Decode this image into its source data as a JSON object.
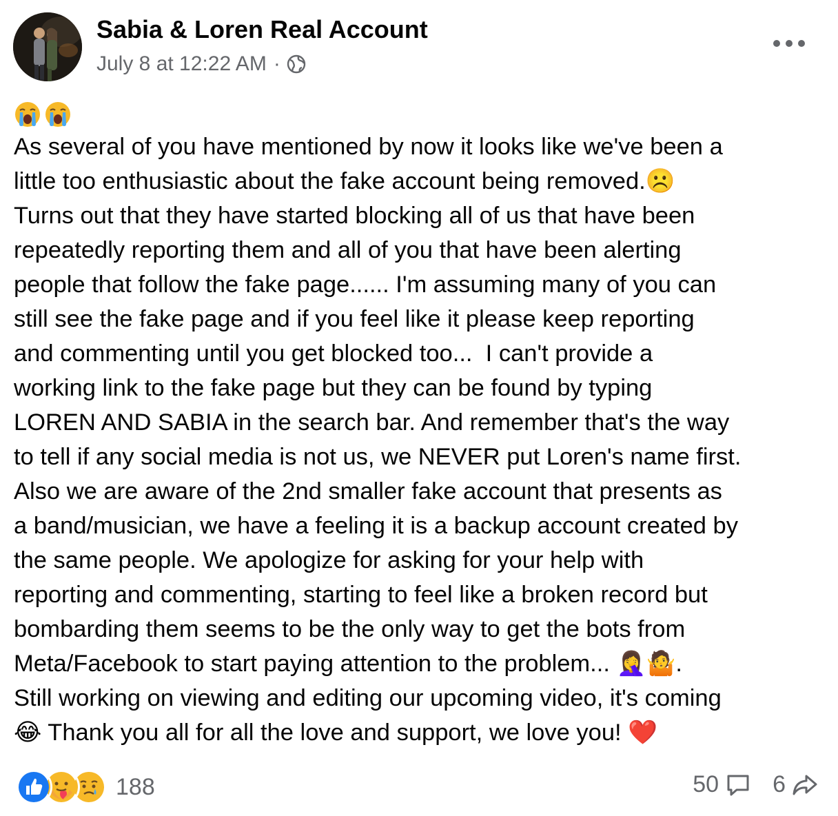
{
  "post": {
    "author": "Sabia & Loren Real Account",
    "timestamp": "July 8 at 12:22 AM",
    "separator": "·",
    "audience_icon": "globe-icon",
    "leading_emoji": [
      "😭",
      "😭"
    ],
    "body_lines": [
      "As several of you have mentioned by now it looks like we've been a",
      "little too enthusiastic about the fake account being removed.☹️",
      "Turns out that they have started blocking all of us that have been",
      "repeatedly reporting them and all of you that have been alerting",
      "people that follow the fake page...... I'm assuming many of you can",
      "still see the fake page and if you feel like it please keep reporting",
      "and commenting until you get blocked too...  I can't provide a",
      "working link to the fake page but they can be found by typing",
      "LOREN AND SABIA in the search bar. And remember that's the way",
      "to tell if any social media is not us, we NEVER put Loren's name first.",
      "Also we are aware of the 2nd smaller fake account that presents as",
      "a band/musician, we have a feeling it is a backup account created by",
      "the same people. We apologize for asking for your help with",
      "reporting and commenting, starting to feel like a broken record but",
      "bombarding them seems to be the only way to get the bots from",
      "Meta/Facebook to start paying attention to the problem... 🤦‍♀️🤷.",
      "Still working on viewing and editing our upcoming video, it's coming",
      "😂 Thank you all for all the love and support, we love you! ❤️"
    ]
  },
  "footer": {
    "reaction_icons": [
      "like-icon",
      "care-icon",
      "sad-icon"
    ],
    "reaction_count": "188",
    "comment_count": "50",
    "share_count": "6"
  },
  "colors": {
    "text": "#050505",
    "secondary": "#65676b",
    "like_blue": "#1877f2",
    "emoji_yellow": "#f7b928"
  }
}
